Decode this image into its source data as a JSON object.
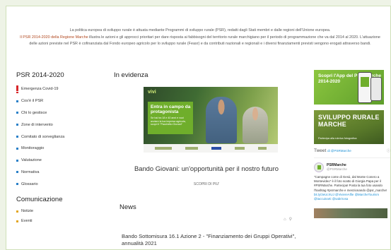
{
  "intro": {
    "line1": "La politica europea di sviluppo rurale è attuata mediante Programmi di sviluppo rurale (PSR), redatti dagli Stati membri e dalle regioni dell'Unione europea.",
    "line2_hl": "Il PSR 2014-2020 della Regione Marche",
    "line2": " illustra le azioni e gli approcci prioritari per dare risposta ai fabbisogni del territorio rurale marchigiano per il periodo di programmazione che va dal 2014 al 2020. L'attuazione delle azioni previste nel PSR è cofinanziata dal Fondo europeo agricolo per lo sviluppo rurale (Feasr) e da contributi nazionali e regionali e i diversi finanziamenti previsti vengono erogati attraverso bandi."
  },
  "sidebar": {
    "title": "PSR 2014-2020",
    "items": [
      {
        "label": "Emergenza Covid-19",
        "icon": "exclamation-icon"
      },
      {
        "label": "Cos'è il PSR"
      },
      {
        "label": "Chi lo gestisce"
      },
      {
        "label": "Zone di intervento"
      },
      {
        "label": "Comitato di sorveglianza"
      },
      {
        "label": "Monitoraggio"
      },
      {
        "label": "Valutazione"
      },
      {
        "label": "Normativa"
      },
      {
        "label": "Glossario"
      }
    ],
    "comm_title": "Comunicazione",
    "comm_items": [
      {
        "label": "Notizie"
      },
      {
        "label": "Eventi"
      }
    ]
  },
  "evidenza": {
    "title": "In evidenza",
    "hero_brand": "vivi",
    "hero_card_title": "Entra in campo da protagonista",
    "hero_card_text": "Se hai tra 18 e 40 anni e vuoi avviare la tua impresa agricola, scopri il \"Pacchetto Giovani\"",
    "caption": "Bando Giovani: un'opportunità per il nostro futuro",
    "link": "SCOPRI DI PIU'"
  },
  "news": {
    "title": "News",
    "item_title": "Bando Sottomisura 16.1 Azione 2 - \"Finanziamento dei Gruppi Operativi\", annualità 2021"
  },
  "right": {
    "banner1_text": "Scopri l'App del PSR Marche 2014-2020",
    "banner2_text": "SVILUPPO RURALE MARCHE",
    "banner2_sub": "Partecipa alla rubrica fotografica",
    "tweets_label": "Tweet",
    "tweets_by": "di @PSRMarche",
    "tweet_name": "PSRMarche",
    "tweet_handle": "@PSRMarche",
    "tweet_text": "\"Campagne come di Gesù, dal Monte Conero a Montevideo\" è il foto scatto di Giorgia Papa per il #PSRMarche. Partecipa! Posta la tua foto usando l'hashtag #psrmarche e menzionando @psr_marche!",
    "tweet_links": "bit.ly/3eUcXUJ @ViviereAlfie @MarcheTourism @taccuinarti @sabrirosa"
  }
}
